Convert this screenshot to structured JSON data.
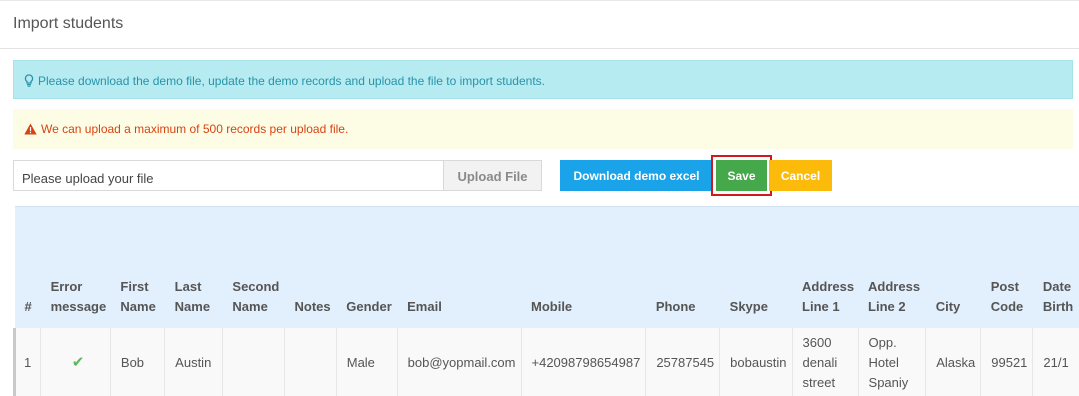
{
  "page": {
    "title": "Import students"
  },
  "alerts": {
    "info": "Please download the demo file, update the demo records and upload the file to import students.",
    "warning": "We can upload a maximum of 500 records per upload file."
  },
  "upload": {
    "placeholder": "Please upload your file",
    "upload_label": "Upload File"
  },
  "buttons": {
    "download": "Download demo excel",
    "save": "Save",
    "cancel": "Cancel"
  },
  "table": {
    "headers": [
      {
        "l1": "",
        "l2": "#"
      },
      {
        "l1": "Error",
        "l2": "message"
      },
      {
        "l1": "First",
        "l2": "Name"
      },
      {
        "l1": "Last",
        "l2": "Name"
      },
      {
        "l1": "Second",
        "l2": "Name"
      },
      {
        "l1": "",
        "l2": "Notes"
      },
      {
        "l1": "",
        "l2": "Gender"
      },
      {
        "l1": "",
        "l2": "Email"
      },
      {
        "l1": "",
        "l2": "Mobile"
      },
      {
        "l1": "",
        "l2": "Phone"
      },
      {
        "l1": "",
        "l2": "Skype"
      },
      {
        "l1": "Address",
        "l2": "Line 1"
      },
      {
        "l1": "Address",
        "l2": "Line 2"
      },
      {
        "l1": "",
        "l2": "City"
      },
      {
        "l1": "Post",
        "l2": "Code"
      },
      {
        "l1": "Date",
        "l2": "Birth"
      }
    ],
    "rows": [
      {
        "num": "1",
        "error": "✔",
        "first": "Bob",
        "last": "Austin",
        "second": "",
        "notes": "",
        "gender": "Male",
        "email": "bob@yopmail.com",
        "mobile": "+42098798654987",
        "phone": "25787545",
        "skype": "bobaustin",
        "addr1": "3600 denali street",
        "addr2": "Opp. Hotel Spaniy",
        "city": "Alaska",
        "post": "99521",
        "dob": "21/1"
      }
    ]
  },
  "colors": {
    "info_bg": "#b5ebf1",
    "warning_text": "#d84315",
    "download_btn": "#1aa3e8",
    "save_btn": "#45a84a",
    "cancel_btn": "#fcbb0a",
    "highlight": "#d01a1a"
  },
  "icons": {
    "info": "lightbulb-icon",
    "warning": "warning-triangle-icon",
    "error_ok": "checkmark-icon"
  }
}
